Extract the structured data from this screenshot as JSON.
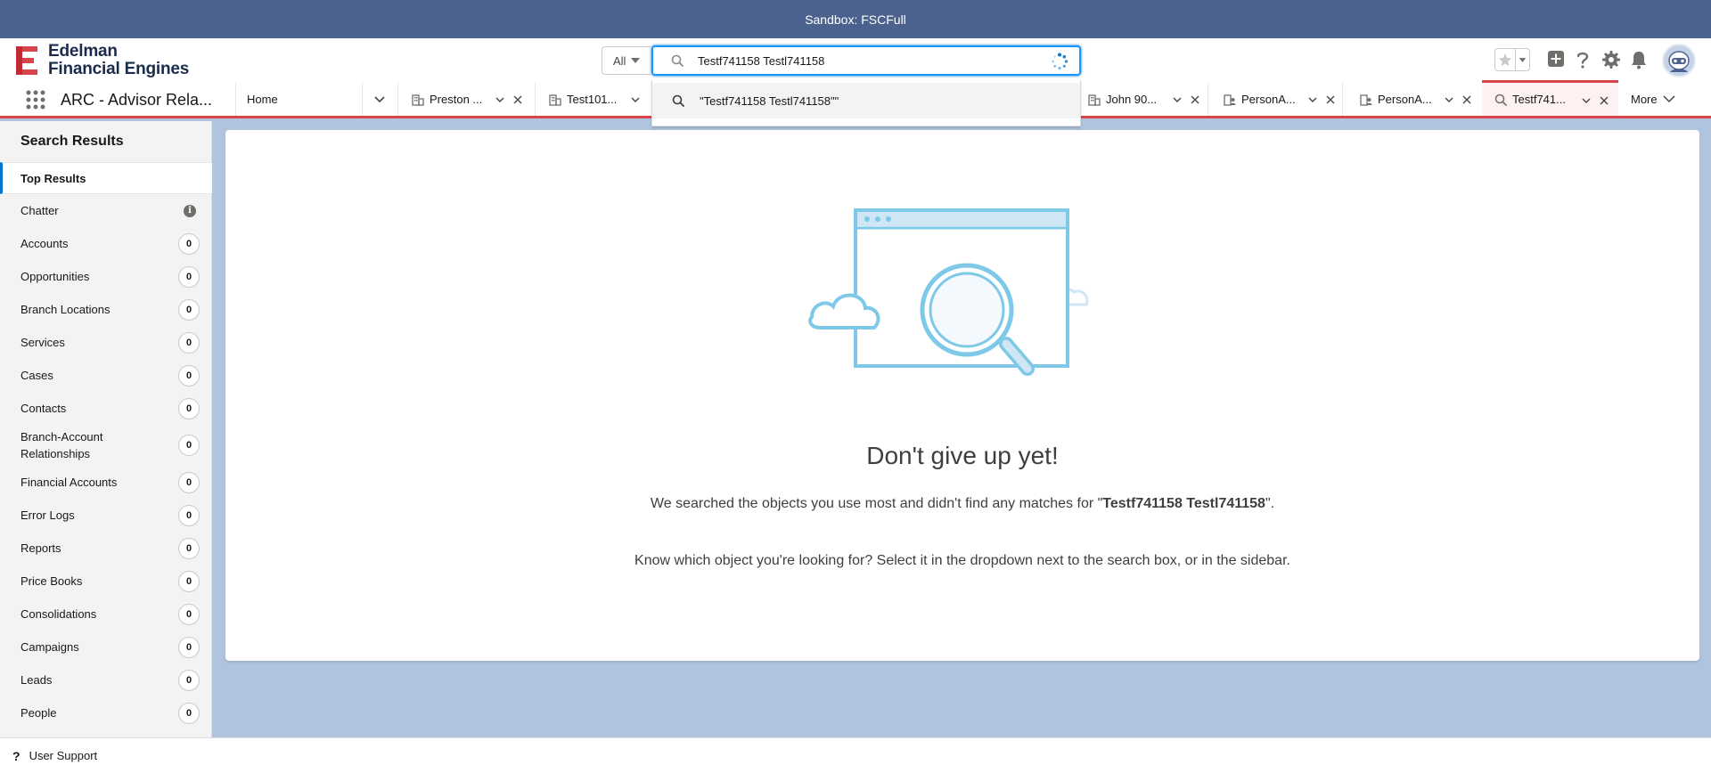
{
  "sandbox": {
    "label": "Sandbox: FSCFull"
  },
  "logo": {
    "line1": "Edelman",
    "line2": "Financial Engines"
  },
  "search": {
    "scope": "All",
    "query": "Testf741158 Testl741158",
    "suggestion": "\"Testf741158 Testl741158\"\""
  },
  "nav": {
    "app_name": "ARC - Advisor Rela...",
    "home": "Home",
    "tabs": [
      {
        "label": "Preston ...",
        "icon": "building-icon"
      },
      {
        "label": "Test101...",
        "icon": "building-icon"
      },
      {
        "label": "John 90...",
        "icon": "building-icon"
      },
      {
        "label": "PersonA...",
        "icon": "person-account-icon"
      },
      {
        "label": "PersonA...",
        "icon": "person-account-icon"
      },
      {
        "label": "Testf741...",
        "icon": "search-icon"
      }
    ],
    "more": "More"
  },
  "sidebar": {
    "title": "Search Results",
    "top": "Top Results",
    "chatter": "Chatter",
    "items": [
      {
        "label": "Accounts",
        "count": "0"
      },
      {
        "label": "Opportunities",
        "count": "0"
      },
      {
        "label": "Branch Locations",
        "count": "0"
      },
      {
        "label": "Services",
        "count": "0"
      },
      {
        "label": "Cases",
        "count": "0"
      },
      {
        "label": "Contacts",
        "count": "0"
      },
      {
        "label": "Branch-Account Relationships",
        "count": "0"
      },
      {
        "label": "Financial Accounts",
        "count": "0"
      },
      {
        "label": "Error Logs",
        "count": "0"
      },
      {
        "label": "Reports",
        "count": "0"
      },
      {
        "label": "Price Books",
        "count": "0"
      },
      {
        "label": "Consolidations",
        "count": "0"
      },
      {
        "label": "Campaigns",
        "count": "0"
      },
      {
        "label": "Leads",
        "count": "0"
      },
      {
        "label": "People",
        "count": "0"
      }
    ]
  },
  "main": {
    "headline": "Don't give up yet!",
    "msg1_pre": "We searched the objects you use most and didn't find any matches for \"",
    "msg1_term": "Testf741158 Testl741158",
    "msg1_post": "\".",
    "msg2": "Know which object you're looking for? Select it in the dropdown next to the search box, or in the sidebar."
  },
  "utility": {
    "support": "User Support"
  },
  "colors": {
    "brand": "#0176d3",
    "accent_red": "#d9434e",
    "sandbox_bar": "#4b628f"
  }
}
